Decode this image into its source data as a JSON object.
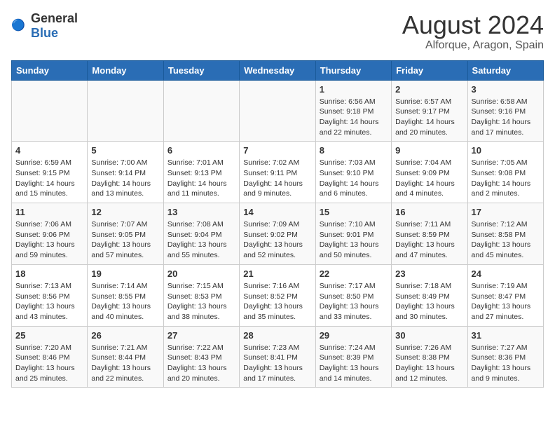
{
  "header": {
    "logo_general": "General",
    "logo_blue": "Blue",
    "title": "August 2024",
    "subtitle": "Alforque, Aragon, Spain"
  },
  "calendar": {
    "days_of_week": [
      "Sunday",
      "Monday",
      "Tuesday",
      "Wednesday",
      "Thursday",
      "Friday",
      "Saturday"
    ],
    "weeks": [
      [
        {
          "day": "",
          "info": ""
        },
        {
          "day": "",
          "info": ""
        },
        {
          "day": "",
          "info": ""
        },
        {
          "day": "",
          "info": ""
        },
        {
          "day": "1",
          "info": "Sunrise: 6:56 AM\nSunset: 9:18 PM\nDaylight: 14 hours\nand 22 minutes."
        },
        {
          "day": "2",
          "info": "Sunrise: 6:57 AM\nSunset: 9:17 PM\nDaylight: 14 hours\nand 20 minutes."
        },
        {
          "day": "3",
          "info": "Sunrise: 6:58 AM\nSunset: 9:16 PM\nDaylight: 14 hours\nand 17 minutes."
        }
      ],
      [
        {
          "day": "4",
          "info": "Sunrise: 6:59 AM\nSunset: 9:15 PM\nDaylight: 14 hours\nand 15 minutes."
        },
        {
          "day": "5",
          "info": "Sunrise: 7:00 AM\nSunset: 9:14 PM\nDaylight: 14 hours\nand 13 minutes."
        },
        {
          "day": "6",
          "info": "Sunrise: 7:01 AM\nSunset: 9:13 PM\nDaylight: 14 hours\nand 11 minutes."
        },
        {
          "day": "7",
          "info": "Sunrise: 7:02 AM\nSunset: 9:11 PM\nDaylight: 14 hours\nand 9 minutes."
        },
        {
          "day": "8",
          "info": "Sunrise: 7:03 AM\nSunset: 9:10 PM\nDaylight: 14 hours\nand 6 minutes."
        },
        {
          "day": "9",
          "info": "Sunrise: 7:04 AM\nSunset: 9:09 PM\nDaylight: 14 hours\nand 4 minutes."
        },
        {
          "day": "10",
          "info": "Sunrise: 7:05 AM\nSunset: 9:08 PM\nDaylight: 14 hours\nand 2 minutes."
        }
      ],
      [
        {
          "day": "11",
          "info": "Sunrise: 7:06 AM\nSunset: 9:06 PM\nDaylight: 13 hours\nand 59 minutes."
        },
        {
          "day": "12",
          "info": "Sunrise: 7:07 AM\nSunset: 9:05 PM\nDaylight: 13 hours\nand 57 minutes."
        },
        {
          "day": "13",
          "info": "Sunrise: 7:08 AM\nSunset: 9:04 PM\nDaylight: 13 hours\nand 55 minutes."
        },
        {
          "day": "14",
          "info": "Sunrise: 7:09 AM\nSunset: 9:02 PM\nDaylight: 13 hours\nand 52 minutes."
        },
        {
          "day": "15",
          "info": "Sunrise: 7:10 AM\nSunset: 9:01 PM\nDaylight: 13 hours\nand 50 minutes."
        },
        {
          "day": "16",
          "info": "Sunrise: 7:11 AM\nSunset: 8:59 PM\nDaylight: 13 hours\nand 47 minutes."
        },
        {
          "day": "17",
          "info": "Sunrise: 7:12 AM\nSunset: 8:58 PM\nDaylight: 13 hours\nand 45 minutes."
        }
      ],
      [
        {
          "day": "18",
          "info": "Sunrise: 7:13 AM\nSunset: 8:56 PM\nDaylight: 13 hours\nand 43 minutes."
        },
        {
          "day": "19",
          "info": "Sunrise: 7:14 AM\nSunset: 8:55 PM\nDaylight: 13 hours\nand 40 minutes."
        },
        {
          "day": "20",
          "info": "Sunrise: 7:15 AM\nSunset: 8:53 PM\nDaylight: 13 hours\nand 38 minutes."
        },
        {
          "day": "21",
          "info": "Sunrise: 7:16 AM\nSunset: 8:52 PM\nDaylight: 13 hours\nand 35 minutes."
        },
        {
          "day": "22",
          "info": "Sunrise: 7:17 AM\nSunset: 8:50 PM\nDaylight: 13 hours\nand 33 minutes."
        },
        {
          "day": "23",
          "info": "Sunrise: 7:18 AM\nSunset: 8:49 PM\nDaylight: 13 hours\nand 30 minutes."
        },
        {
          "day": "24",
          "info": "Sunrise: 7:19 AM\nSunset: 8:47 PM\nDaylight: 13 hours\nand 27 minutes."
        }
      ],
      [
        {
          "day": "25",
          "info": "Sunrise: 7:20 AM\nSunset: 8:46 PM\nDaylight: 13 hours\nand 25 minutes."
        },
        {
          "day": "26",
          "info": "Sunrise: 7:21 AM\nSunset: 8:44 PM\nDaylight: 13 hours\nand 22 minutes."
        },
        {
          "day": "27",
          "info": "Sunrise: 7:22 AM\nSunset: 8:43 PM\nDaylight: 13 hours\nand 20 minutes."
        },
        {
          "day": "28",
          "info": "Sunrise: 7:23 AM\nSunset: 8:41 PM\nDaylight: 13 hours\nand 17 minutes."
        },
        {
          "day": "29",
          "info": "Sunrise: 7:24 AM\nSunset: 8:39 PM\nDaylight: 13 hours\nand 14 minutes."
        },
        {
          "day": "30",
          "info": "Sunrise: 7:26 AM\nSunset: 8:38 PM\nDaylight: 13 hours\nand 12 minutes."
        },
        {
          "day": "31",
          "info": "Sunrise: 7:27 AM\nSunset: 8:36 PM\nDaylight: 13 hours\nand 9 minutes."
        }
      ]
    ]
  }
}
